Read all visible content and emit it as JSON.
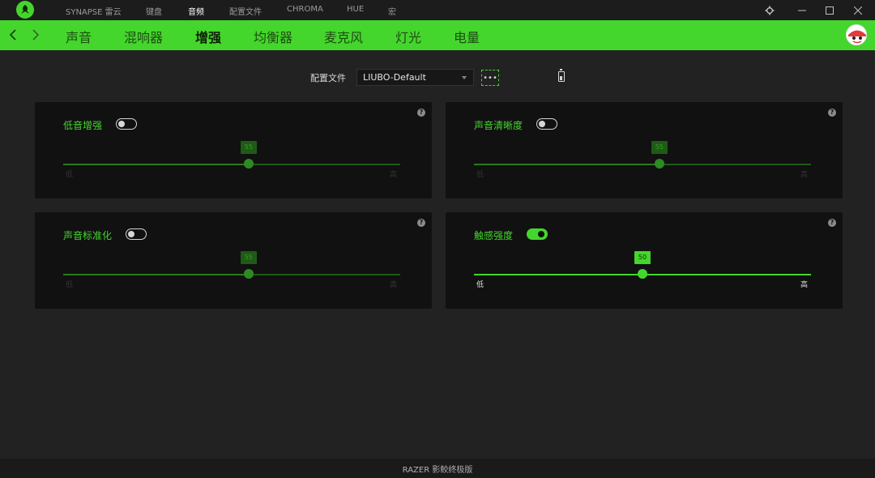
{
  "top_nav": {
    "items": [
      "SYNAPSE 雷云",
      "键盘",
      "音频",
      "配置文件",
      "CHROMA",
      "HUE",
      "宏"
    ],
    "active_index": 2
  },
  "tabs": {
    "items": [
      "声音",
      "混响器",
      "增强",
      "均衡器",
      "麦克风",
      "灯光",
      "电量"
    ],
    "active_index": 2
  },
  "profile": {
    "label": "配置文件",
    "selected": "LIUBO-Default",
    "more_label": "•••"
  },
  "panels": [
    {
      "title": "低音增强",
      "enabled": false,
      "value": 55,
      "low_label": "低",
      "high_label": "高",
      "help": "?"
    },
    {
      "title": "声音清晰度",
      "enabled": false,
      "value": 55,
      "low_label": "低",
      "high_label": "高",
      "help": "?"
    },
    {
      "title": "声音标准化",
      "enabled": false,
      "value": 55,
      "low_label": "低",
      "high_label": "高",
      "help": "?"
    },
    {
      "title": "触感强度",
      "enabled": true,
      "value": 50,
      "low_label": "低",
      "high_label": "高",
      "help": "?"
    }
  ],
  "footer": {
    "text": "RAZER 影鲛终极版"
  },
  "colors": {
    "accent": "#44d62c",
    "background": "#222222",
    "panel": "#111111"
  },
  "icons": {
    "logo": "razer-logo-icon",
    "back": "chevron-left-icon",
    "forward": "chevron-right-icon",
    "settings": "gear-icon",
    "minimize": "minimize-icon",
    "maximize": "maximize-icon",
    "close": "close-icon",
    "battery": "battery-icon",
    "help": "help-icon"
  }
}
